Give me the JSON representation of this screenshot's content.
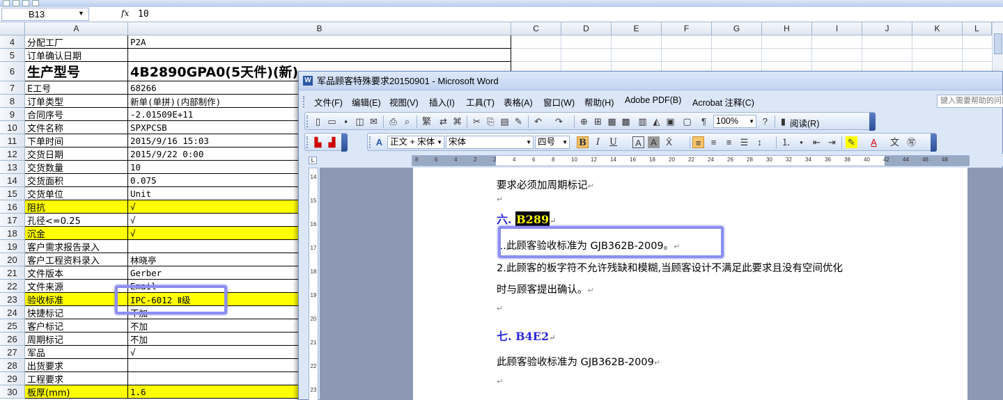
{
  "excel": {
    "name_box": "B13",
    "fx_symbol": "fx",
    "formula_value": "10",
    "columns": [
      "A",
      "B",
      "C",
      "D",
      "E",
      "F",
      "G",
      "H",
      "I",
      "J",
      "K",
      "L"
    ],
    "rows": [
      {
        "num": "4",
        "a": "分配工厂",
        "b": "P2A"
      },
      {
        "num": "5",
        "a": "订单确认日期",
        "b": ""
      },
      {
        "num": "6",
        "a": "生产型号",
        "b": "4B2890GPA0(5天件)(新)"
      },
      {
        "num": "7",
        "a": "E工号",
        "b": "68266"
      },
      {
        "num": "8",
        "a": "订单类型",
        "b": "新单(单拼)(内部制作)"
      },
      {
        "num": "9",
        "a": "合同序号",
        "b": "-2.01509E+11"
      },
      {
        "num": "10",
        "a": "文件名称",
        "b": "SPXPCSB"
      },
      {
        "num": "11",
        "a": "下单时间",
        "b": "2015/9/16 15:03"
      },
      {
        "num": "12",
        "a": "交货日期",
        "b": "2015/9/22 0:00"
      },
      {
        "num": "13",
        "a": "交货数量",
        "b": "10"
      },
      {
        "num": "14",
        "a": "交货面积",
        "b": "0.075"
      },
      {
        "num": "15",
        "a": "交货单位",
        "b": "Unit"
      },
      {
        "num": "16",
        "a": "阻抗",
        "b": "√"
      },
      {
        "num": "17",
        "a": "孔径<=0.25",
        "b": "√"
      },
      {
        "num": "18",
        "a": "沉金",
        "b": "√"
      },
      {
        "num": "19",
        "a": "客户需求报告录入",
        "b": ""
      },
      {
        "num": "20",
        "a": "客户工程资料录入",
        "b": "林晓亭"
      },
      {
        "num": "21",
        "a": "文件版本",
        "b": "Gerber"
      },
      {
        "num": "22",
        "a": "文件来源",
        "b": "Email"
      },
      {
        "num": "23",
        "a": "验收标准",
        "b": "IPC-6012 Ⅱ级"
      },
      {
        "num": "24",
        "a": "快捷标记",
        "b": "不加"
      },
      {
        "num": "25",
        "a": "客户标记",
        "b": "不加"
      },
      {
        "num": "26",
        "a": "周期标记",
        "b": "不加"
      },
      {
        "num": "27",
        "a": "军品",
        "b": "√"
      },
      {
        "num": "28",
        "a": "出货要求",
        "b": ""
      },
      {
        "num": "29",
        "a": "工程要求",
        "b": ""
      },
      {
        "num": "30",
        "a": "板厚(mm)",
        "b": "1.6"
      }
    ],
    "highlight_color": "#ffff00"
  },
  "word": {
    "title": "军品顾客特殊要求20150901 - Microsoft Word",
    "menus": [
      "文件(F)",
      "编辑(E)",
      "视图(V)",
      "插入(I)",
      "工具(T)",
      "表格(A)",
      "窗口(W)",
      "帮助(H)",
      "Adobe PDF(B)",
      "Acrobat 注释(C)"
    ],
    "help_placeholder": "键入需要帮助的问题",
    "zoom": "100%",
    "reading_mode": "阅读(R)",
    "style": "正文 + 宋体",
    "font": "宋体",
    "font_size": "四号",
    "ruler_ticks": [
      "8",
      "6",
      "4",
      "2",
      "2",
      "4",
      "6",
      "8",
      "10",
      "12",
      "14",
      "16",
      "18",
      "20",
      "22",
      "24",
      "26",
      "28",
      "30",
      "32",
      "34",
      "36",
      "38",
      "40",
      "42",
      "44",
      "46",
      "48"
    ],
    "vruler_ticks": [
      "14",
      "15",
      "16",
      "17",
      "18",
      "19",
      "20",
      "21",
      "22",
      "23"
    ],
    "doc": {
      "line1": "要求必须加周期标记",
      "h6_prefix": "六. ",
      "h6_selected": "B289",
      "p1": "1.此顾客验收标准为 GJB362B-2009。",
      "p2": "2.此顾客的板字符不允许残缺和模糊,当顾客设计不满足此要求且没有空间优化",
      "p2b": "时与顾客提出确认。",
      "h7": "七. B4E2",
      "p3": "此顾客验收标准为 GJB362B-2009",
      "para_mark": "↵"
    },
    "heading_color": "#2b2bd9",
    "callout_color": "#8c8ef5"
  }
}
